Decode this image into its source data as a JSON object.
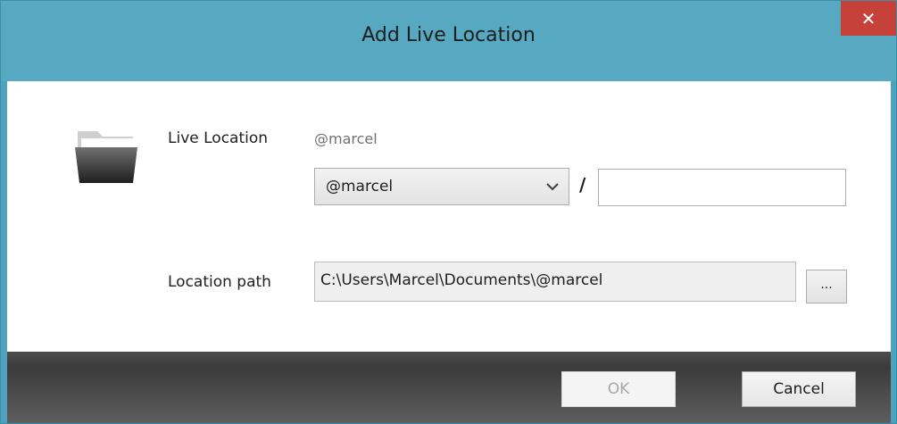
{
  "window": {
    "title": "Add Live Location",
    "close_glyph": "✕",
    "accent_color": "#57a8c1",
    "close_color": "#c7413b"
  },
  "form": {
    "icon": "folder-icon",
    "live_location_label": "Live Location",
    "live_location_value": "@marcel",
    "account_select_value": "@marcel",
    "separator": "/",
    "subpath_value": "",
    "location_path_label": "Location path",
    "location_path_value": "C:\\Users\\Marcel\\Documents\\@marcel",
    "browse_label": "..."
  },
  "footer": {
    "ok_label": "OK",
    "cancel_label": "Cancel"
  }
}
